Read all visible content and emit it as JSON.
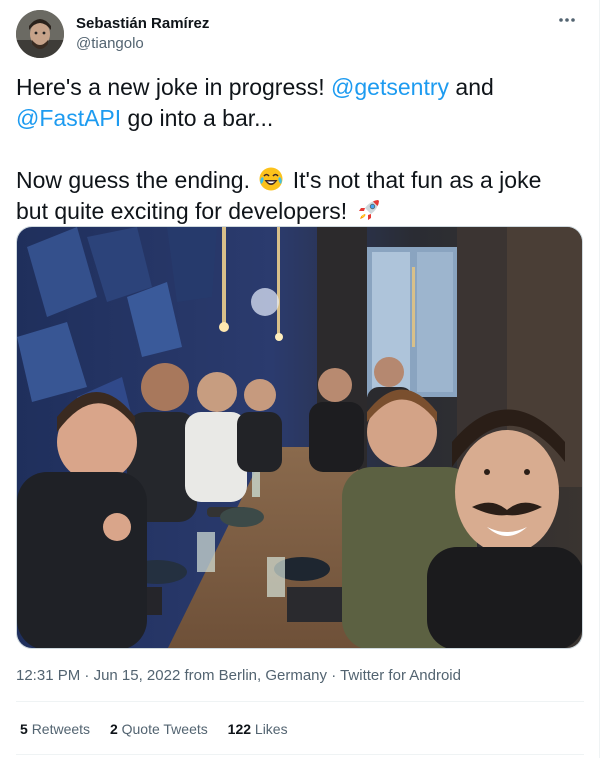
{
  "author": {
    "name": "Sebastián Ramírez",
    "handle": "@tiangolo"
  },
  "tweet": {
    "line1_text": "Here's a new joke in progress! ",
    "mention1": "@getsentry",
    "line1_and": " and",
    "mention2": "@FastAPI",
    "line2_text": " go into a bar...",
    "line3_text": "Now guess the ending. ",
    "line3_after_emoji": " It's not that fun as a joke",
    "line4_text": "but quite exciting for developers! ",
    "emoji1": "face-with-tears-of-joy",
    "emoji2": "rocket"
  },
  "media": {
    "photo": "group-selfie-at-restaurant-table"
  },
  "meta": {
    "time": "12:31 PM",
    "sep1": " · ",
    "date": "Jun 15, 2022",
    "location": " from Berlin, Germany",
    "sep2": " · ",
    "client": "Twitter for Android"
  },
  "stats": {
    "retweets_count": "5",
    "retweets_label": "Retweets",
    "quotes_count": "2",
    "quotes_label": "Quote Tweets",
    "likes_count": "122",
    "likes_label": "Likes"
  },
  "colors": {
    "link": "#1d9bf0",
    "secondary_text": "#536471",
    "primary_text": "#0f1419",
    "divider": "#eff3f4"
  },
  "icons": {
    "more": "more-horizontal-icon"
  }
}
